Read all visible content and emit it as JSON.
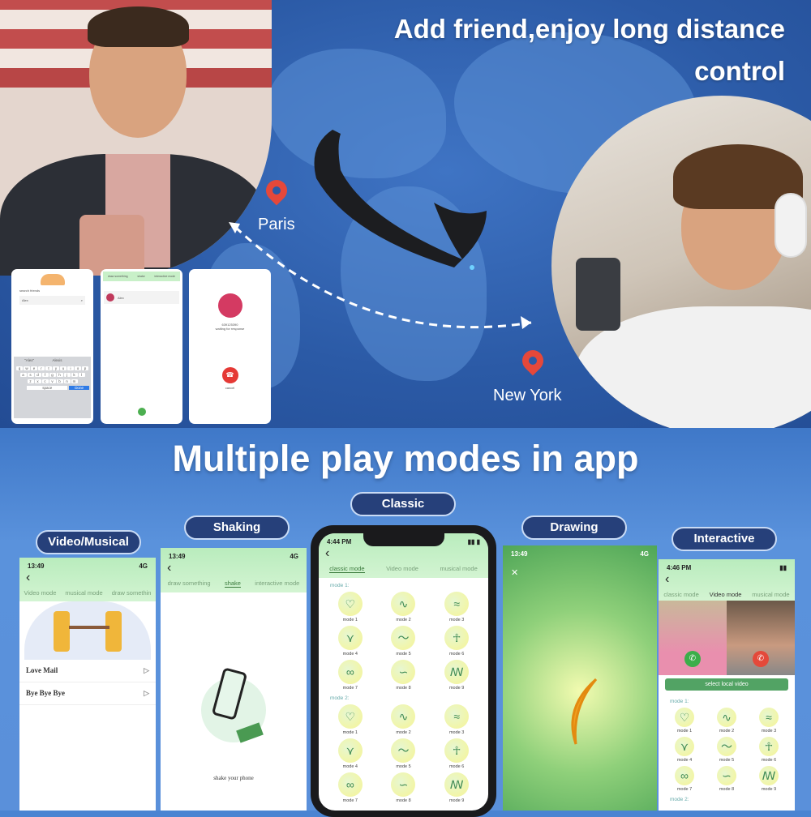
{
  "top": {
    "title_line1": "Add friend,enjoy long distance",
    "title_line2": "control",
    "city_from": "Paris",
    "city_to": "New York",
    "pin_color": "#e5483a",
    "mini_screens": {
      "search": {
        "label": "search friends",
        "input_value": "Alex",
        "suggestions": [
          "\"Alex\"",
          "Alexis"
        ],
        "keys_row1": [
          "q",
          "w",
          "e",
          "r",
          "t",
          "y",
          "u",
          "i",
          "o",
          "p"
        ],
        "keys_row2": [
          "a",
          "s",
          "d",
          "f",
          "g",
          "h",
          "j",
          "k",
          "l"
        ],
        "keys_row3": [
          "z",
          "x",
          "c",
          "v",
          "b",
          "n",
          "m"
        ],
        "space": "space",
        "go": "Done"
      },
      "friends": {
        "tabs": [
          "draw something",
          "shake",
          "interactive mode"
        ],
        "friend_name": "Alex"
      },
      "call": {
        "number": "639125390",
        "status": "waiting for response",
        "cancel": "cancel"
      }
    }
  },
  "bottom": {
    "title": "Multiple play modes in app",
    "pills": {
      "video": "Video/Musical",
      "shaking": "Shaking",
      "classic": "Classic",
      "drawing": "Drawing",
      "interactive": "Interactive"
    },
    "video_screen": {
      "time": "13:49",
      "signal": "4G",
      "tabs": [
        "Video mode",
        "musical mode",
        "draw somethin"
      ],
      "songs": [
        "Love Mail",
        "Bye Bye Bye"
      ]
    },
    "shake_screen": {
      "time": "13:49",
      "signal": "4G",
      "tabs": [
        "draw something",
        "shake",
        "interactive mode"
      ],
      "caption": "shake your phone"
    },
    "classic_screen": {
      "time": "4:44 PM",
      "tabs": [
        "classic mode",
        "Video mode",
        "musical mode"
      ],
      "section1": "mode 1:",
      "section2": "mode 2:",
      "modes": [
        "mode 1",
        "mode 2",
        "mode 3",
        "mode 4",
        "mode 5",
        "mode 6",
        "mode 7",
        "mode 8",
        "mode 9"
      ]
    },
    "drawing_screen": {
      "time": "13:49",
      "signal": "4G"
    },
    "interactive_screen": {
      "time": "4:46 PM",
      "tabs": [
        "classic mode",
        "Video mode",
        "musical mode"
      ],
      "select_video": "select local video",
      "section1": "mode 1:",
      "section2": "mode 2:",
      "modes": [
        "mode 1",
        "mode 2",
        "mode 3",
        "mode 4",
        "mode 5",
        "mode 6",
        "mode 7",
        "mode 8",
        "mode 9"
      ]
    },
    "mode_icons": [
      "heart-pulse-icon",
      "wave-icon",
      "swim-icon",
      "birds-icon",
      "ocean-wave-icon",
      "dance-icon",
      "infinity-icon",
      "swimmer-icon",
      "surf-icon"
    ]
  },
  "colors": {
    "top_bg": "#2b5aa6",
    "bottom_bg": "#5a90da",
    "pill_bg": "#26407a",
    "app_green": "#b9ecbd",
    "accent_green": "#3a9a4c"
  }
}
